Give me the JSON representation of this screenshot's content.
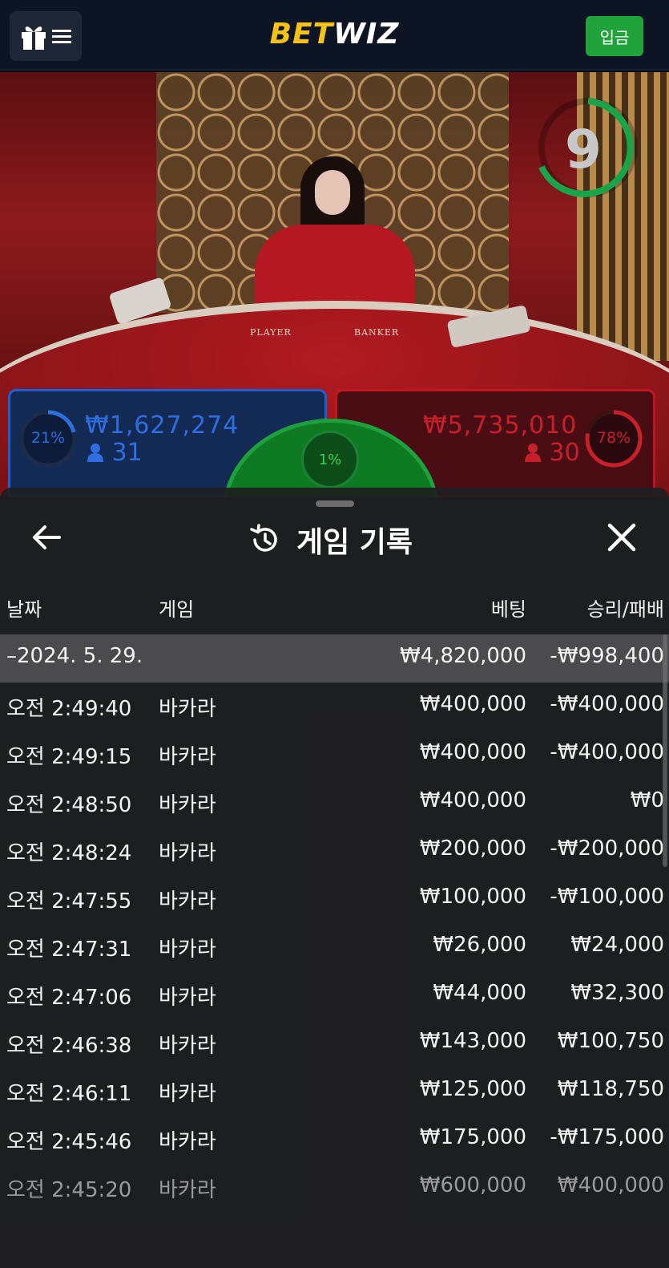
{
  "header": {
    "logo_bet": "BET",
    "logo_wiz": "WIZ",
    "deposit_label": "입금"
  },
  "video": {
    "timer": "9",
    "table_player_label": "PLAYER",
    "table_banker_label": "BANKER"
  },
  "bets": {
    "player": {
      "percent": "21%",
      "percent_value": 0.21,
      "amount": "₩1,627,274",
      "count": "31",
      "color": "#2e6ee0"
    },
    "banker": {
      "percent": "78%",
      "percent_value": 0.78,
      "amount": "₩5,735,010",
      "count": "30",
      "color": "#c8202a"
    },
    "tie": {
      "percent": "1%",
      "color": "#1ea13c"
    }
  },
  "history": {
    "title": "게임 기록",
    "columns": {
      "date": "날짜",
      "game": "게임",
      "bet": "베팅",
      "result": "승리/패배"
    },
    "day_row": {
      "date": "–2024. 5. 29.",
      "bet": "₩4,820,000",
      "result": "-₩998,400"
    },
    "rows": [
      {
        "time": "오전 2:49:40",
        "game": "바카라",
        "bet": "₩400,000",
        "result": "-₩400,000"
      },
      {
        "time": "오전 2:49:15",
        "game": "바카라",
        "bet": "₩400,000",
        "result": "-₩400,000"
      },
      {
        "time": "오전 2:48:50",
        "game": "바카라",
        "bet": "₩400,000",
        "result": "₩0"
      },
      {
        "time": "오전 2:48:24",
        "game": "바카라",
        "bet": "₩200,000",
        "result": "-₩200,000"
      },
      {
        "time": "오전 2:47:55",
        "game": "바카라",
        "bet": "₩100,000",
        "result": "-₩100,000"
      },
      {
        "time": "오전 2:47:31",
        "game": "바카라",
        "bet": "₩26,000",
        "result": "₩24,000"
      },
      {
        "time": "오전 2:47:06",
        "game": "바카라",
        "bet": "₩44,000",
        "result": "₩32,300"
      },
      {
        "time": "오전 2:46:38",
        "game": "바카라",
        "bet": "₩143,000",
        "result": "₩100,750"
      },
      {
        "time": "오전 2:46:11",
        "game": "바카라",
        "bet": "₩125,000",
        "result": "₩118,750"
      },
      {
        "time": "오전 2:45:46",
        "game": "바카라",
        "bet": "₩175,000",
        "result": "-₩175,000"
      },
      {
        "time": "오전 2:45:20",
        "game": "바카라",
        "bet": "₩600,000",
        "result": "₩400,000"
      }
    ]
  },
  "icons": {
    "menu": "gift-menu-icon",
    "back": "arrow-left-icon",
    "history": "history-icon",
    "close": "close-icon",
    "user": "user-icon"
  }
}
